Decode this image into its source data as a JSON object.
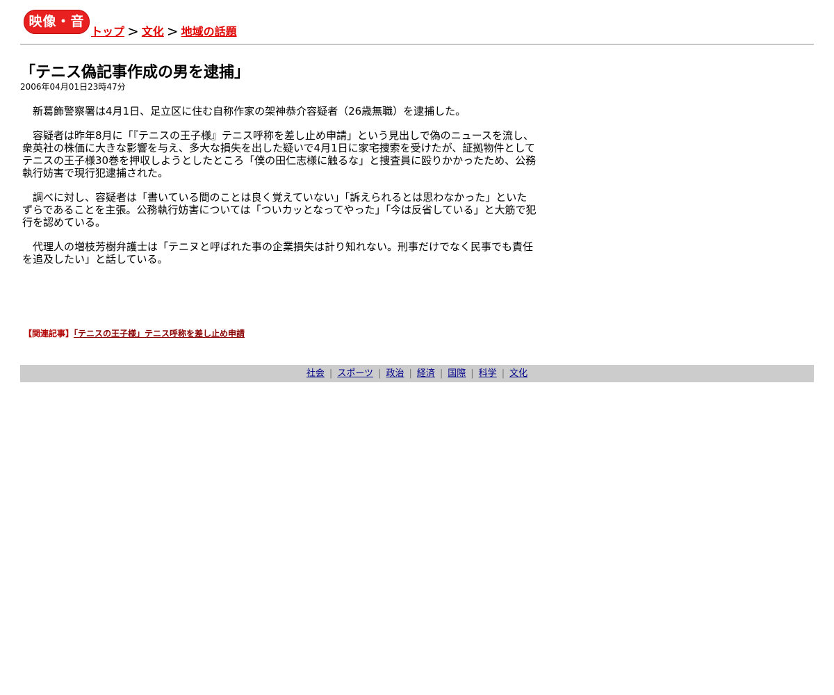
{
  "header": {
    "logo_text": "映像・音楽",
    "breadcrumb": [
      {
        "label": "トップ"
      },
      {
        "label": "文化"
      },
      {
        "label": "地域の話題"
      }
    ],
    "separator": ">"
  },
  "article": {
    "title": "「テニス偽記事作成の男を逮捕」",
    "timestamp": "2006年04月01日23時47分",
    "paragraphs": [
      "新葛飾警察署は4月1日、足立区に住む自称作家の架神恭介容疑者（26歳無職）を逮捕した。",
      "容疑者は昨年8月に「『テニスの王子様』テニス呼称を差し止め申請」という見出しで偽のニュースを流し、衆英社の株価に大きな影響を与え、多大な損失を出した疑いで4月1日に家宅捜索を受けたが、証拠物件としてテニスの王子様30巻を押収しようとしたところ「僕の田仁志様に触るな」と捜査員に殴りかかったため、公務執行妨害で現行犯逮捕された。",
      "調べに対し、容疑者は「書いている間のことは良く覚えていない」「訴えられるとは思わなかった」といたずらであることを主張。公務執行妨害については「ついカッとなってやった」「今は反省している」と大筋で犯行を認めている。",
      "代理人の増枝芳樹弁護士は「テニヌと呼ばれた事の企業損失は計り知れない。刑事だけでなく民事でも責任を追及したい」と話している。"
    ]
  },
  "related": {
    "label": "【関連記事】",
    "link_text": "「テニスの王子様」テニス呼称を差し止め申請"
  },
  "footer_nav": {
    "separator": "|",
    "items": [
      {
        "label": "社会"
      },
      {
        "label": "スポーツ"
      },
      {
        "label": "政治"
      },
      {
        "label": "経済"
      },
      {
        "label": "国際"
      },
      {
        "label": "科学"
      },
      {
        "label": "文化"
      }
    ]
  },
  "colors": {
    "logo_bg": "#e82020",
    "breadcrumb_link": "#e00000",
    "related_link": "#8b0000",
    "footer_bg": "#cccccc",
    "footer_link": "#00008b"
  }
}
